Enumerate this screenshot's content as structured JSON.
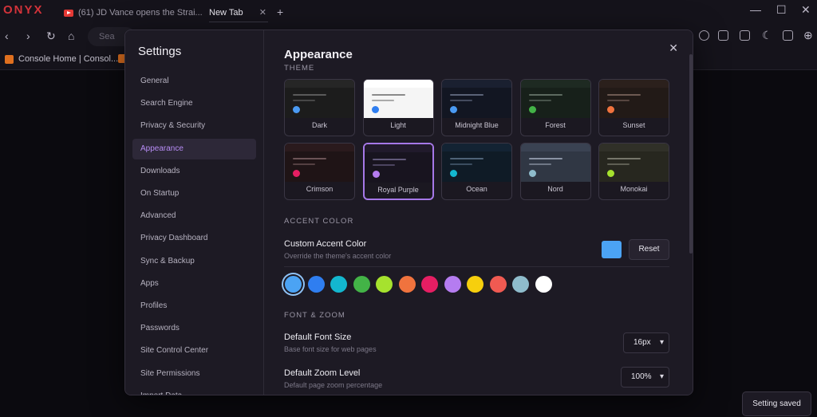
{
  "browser": {
    "logo": "ONYX",
    "tabs": [
      {
        "title": "(61) JD Vance opens the Strai..."
      },
      {
        "title": "New Tab"
      }
    ],
    "new_tab": "+",
    "close": "✕",
    "address_placeholder": "Sea",
    "bookmark": "Console Home | Consol..."
  },
  "settings": {
    "title": "Settings",
    "nav": [
      {
        "label": "General"
      },
      {
        "label": "Search Engine"
      },
      {
        "label": "Privacy & Security"
      },
      {
        "label": "Appearance",
        "active": true
      },
      {
        "label": "Downloads"
      },
      {
        "label": "On Startup"
      },
      {
        "label": "Advanced"
      },
      {
        "label": "Privacy Dashboard"
      },
      {
        "label": "Sync & Backup"
      },
      {
        "label": "Apps"
      },
      {
        "label": "Profiles"
      },
      {
        "label": "Passwords"
      },
      {
        "label": "Site Control Center"
      },
      {
        "label": "Site Permissions"
      },
      {
        "label": "Import Data"
      }
    ]
  },
  "appearance": {
    "title": "Appearance",
    "theme_label": "THEME",
    "themes": [
      {
        "name": "Dark",
        "bg": "#1c1c1c",
        "top": "#262626",
        "line": "#5a5a5a",
        "accent": "#4a9af2"
      },
      {
        "name": "Light",
        "bg": "#f5f5f5",
        "top": "#ffffff",
        "line": "#8a8a8a",
        "accent": "#2f7ef0"
      },
      {
        "name": "Midnight Blue",
        "bg": "#121622",
        "top": "#1a2030",
        "line": "#5a6277",
        "accent": "#4a9af2"
      },
      {
        "name": "Forest",
        "bg": "#17201a",
        "top": "#1e2a22",
        "line": "#5d6a60",
        "accent": "#43b347"
      },
      {
        "name": "Sunset",
        "bg": "#221a17",
        "top": "#2b201c",
        "line": "#6d5a52",
        "accent": "#f0733e"
      },
      {
        "name": "Crimson",
        "bg": "#1f1416",
        "top": "#2a1a1d",
        "line": "#6b5356",
        "accent": "#e61e63"
      },
      {
        "name": "Royal Purple",
        "bg": "#18141f",
        "top": "#211a2b",
        "line": "#62597a",
        "accent": "#b57cf0",
        "selected": true
      },
      {
        "name": "Ocean",
        "bg": "#0f1b26",
        "top": "#132333",
        "line": "#4e6277",
        "accent": "#13b7cf"
      },
      {
        "name": "Nord",
        "bg": "#303744",
        "top": "#3a4252",
        "line": "#8a93a3",
        "accent": "#8fbccc"
      },
      {
        "name": "Monokai",
        "bg": "#27271f",
        "top": "#303028",
        "line": "#76766a",
        "accent": "#a6e22e"
      }
    ],
    "accent_label": "ACCENT COLOR",
    "custom_accent_title": "Custom Accent Color",
    "custom_accent_sub": "Override the theme's accent color",
    "custom_accent_value": "#4ba3f4",
    "reset_label": "Reset",
    "accent_colors": [
      "#4ba3f4",
      "#2f7ef0",
      "#13b7cf",
      "#43b347",
      "#a6e22e",
      "#f0733e",
      "#e61e63",
      "#b57cf0",
      "#f6cf0d",
      "#f05a52",
      "#8fbccc",
      "#ffffff"
    ],
    "selected_accent_index": 0,
    "font_zoom_label": "FONT & ZOOM",
    "font_size_title": "Default Font Size",
    "font_size_sub": "Base font size for web pages",
    "font_size_value": "16px",
    "zoom_title": "Default Zoom Level",
    "zoom_sub": "Default page zoom percentage",
    "zoom_value": "100%"
  },
  "toast": "Setting saved"
}
